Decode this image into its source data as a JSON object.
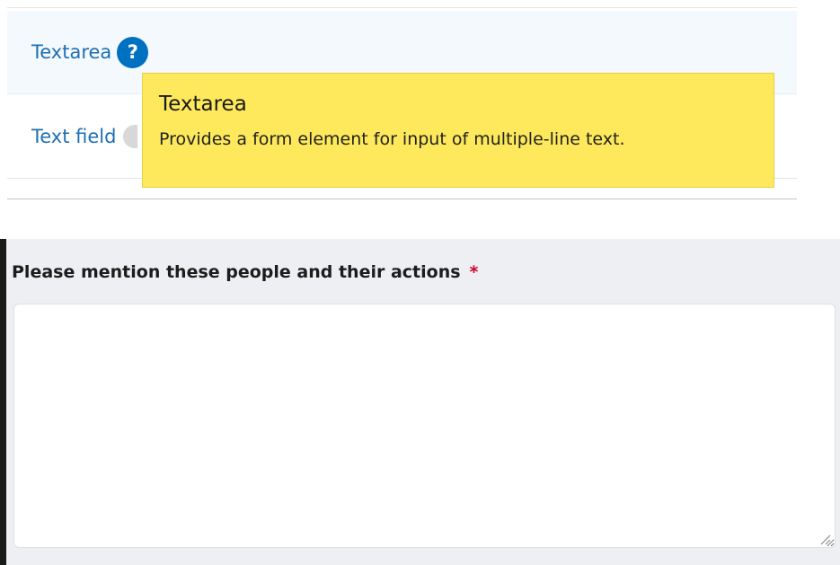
{
  "element_list": {
    "rows": [
      {
        "label": "Textarea",
        "help_icon": "question-mark-icon",
        "help_glyph": "?"
      },
      {
        "label": "Text field",
        "help_icon": "question-mark-icon"
      }
    ]
  },
  "tooltip": {
    "title": "Textarea",
    "description": "Provides a form element for input of multiple-line text.",
    "background_color": "#fde95b"
  },
  "form_preview": {
    "field_label": "Please mention these people and their actions",
    "required_marker": "*",
    "required_color": "#d2002a",
    "textarea_value": ""
  },
  "colors": {
    "link": "#1f6fb3",
    "help_icon": "#0070c1"
  }
}
